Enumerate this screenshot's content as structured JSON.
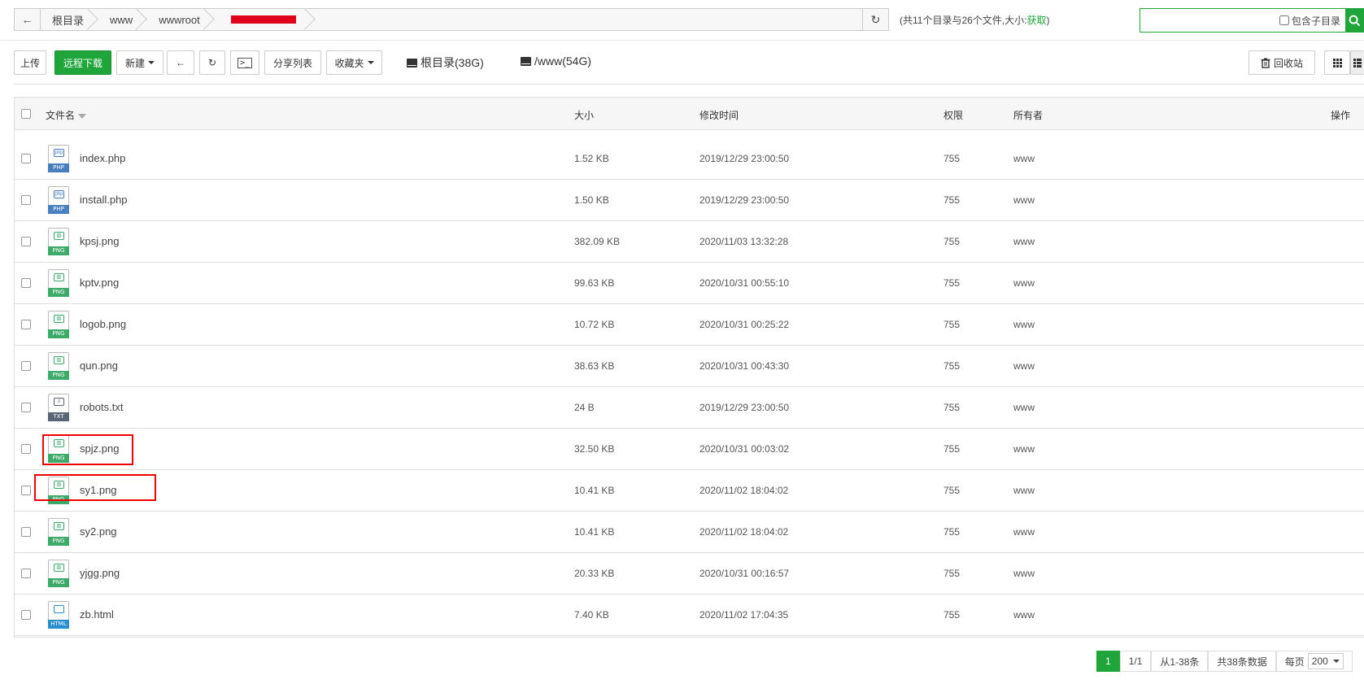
{
  "breadcrumb": {
    "back": "←",
    "items": [
      "根目录",
      "www",
      "wwwroot"
    ],
    "refresh": "↻"
  },
  "summary": {
    "text": "(共11个目录与26个文件,大小:",
    "link": "获取",
    "close": ")"
  },
  "search": {
    "placeholder": "",
    "subdir_label": "包含子目录",
    "button_icon": "search-icon"
  },
  "toolbar": {
    "upload": "上传",
    "remote_download": "远程下载",
    "new": "新建",
    "back": "←",
    "refresh": "↻",
    "terminal": ">_",
    "share_list": "分享列表",
    "favorites": "收藏夹",
    "disk_root": "根目录(38G)",
    "disk_www": "/www(54G)",
    "recycle": "回收站"
  },
  "table": {
    "headers": {
      "name": "文件名",
      "size": "大小",
      "mtime": "修改时间",
      "perm": "权限",
      "owner": "所有者",
      "ops": "操作"
    },
    "rows": [
      {
        "name": "index.php",
        "type": "PHP",
        "size": "1.52 KB",
        "mtime": "2019/12/29 23:00:50",
        "perm": "755",
        "owner": "www"
      },
      {
        "name": "install.php",
        "type": "PHP",
        "size": "1.50 KB",
        "mtime": "2019/12/29 23:00:50",
        "perm": "755",
        "owner": "www"
      },
      {
        "name": "kpsj.png",
        "type": "PNG",
        "size": "382.09 KB",
        "mtime": "2020/11/03 13:32:28",
        "perm": "755",
        "owner": "www"
      },
      {
        "name": "kptv.png",
        "type": "PNG",
        "size": "99.63 KB",
        "mtime": "2020/10/31 00:55:10",
        "perm": "755",
        "owner": "www"
      },
      {
        "name": "logob.png",
        "type": "PNG",
        "size": "10.72 KB",
        "mtime": "2020/10/31 00:25:22",
        "perm": "755",
        "owner": "www"
      },
      {
        "name": "qun.png",
        "type": "PNG",
        "size": "38.63 KB",
        "mtime": "2020/10/31 00:43:30",
        "perm": "755",
        "owner": "www"
      },
      {
        "name": "robots.txt",
        "type": "TXT",
        "size": "24 B",
        "mtime": "2019/12/29 23:00:50",
        "perm": "755",
        "owner": "www"
      },
      {
        "name": "spjz.png",
        "type": "PNG",
        "size": "32.50 KB",
        "mtime": "2020/10/31 00:03:02",
        "perm": "755",
        "owner": "www"
      },
      {
        "name": "sy1.png",
        "type": "PNG",
        "size": "10.41 KB",
        "mtime": "2020/11/02 18:04:02",
        "perm": "755",
        "owner": "www"
      },
      {
        "name": "sy2.png",
        "type": "PNG",
        "size": "10.41 KB",
        "mtime": "2020/11/02 18:04:02",
        "perm": "755",
        "owner": "www"
      },
      {
        "name": "yjgg.png",
        "type": "PNG",
        "size": "20.33 KB",
        "mtime": "2020/10/31 00:16:57",
        "perm": "755",
        "owner": "www"
      },
      {
        "name": "zb.html",
        "type": "HTML",
        "size": "7.40 KB",
        "mtime": "2020/11/02 17:04:35",
        "perm": "755",
        "owner": "www"
      }
    ]
  },
  "pagination": {
    "current": "1",
    "pages": "1/1",
    "range": "从1-38条",
    "total": "共38条数据",
    "per_page_label": "每页",
    "per_page_value": "200"
  },
  "colors": {
    "accent": "#20a53a",
    "php": "#4a7fbf",
    "png": "#3daa6a",
    "txt": "#5a6477",
    "html": "#2a8fcf",
    "highlight": "#ee0000"
  }
}
